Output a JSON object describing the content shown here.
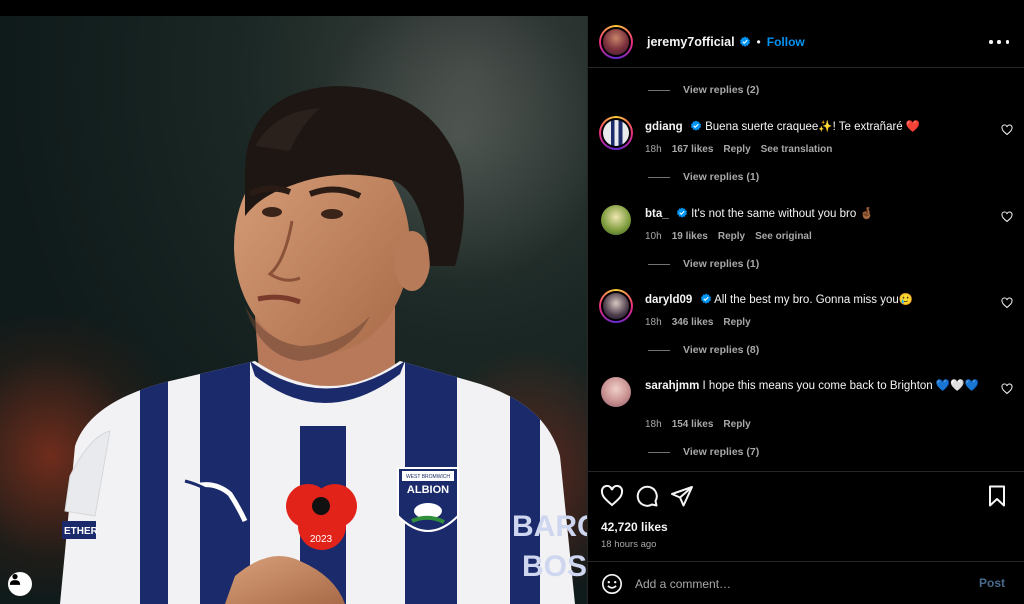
{
  "post": {
    "author": "jeremy7official",
    "follow_label": "Follow",
    "separator": "•",
    "likes": "42,720 likes",
    "time_ago": "18 hours ago"
  },
  "comments": [
    {
      "type": "replies",
      "label": "View replies (2)"
    },
    {
      "type": "comment",
      "user": "gdiang",
      "verified": true,
      "text": "Buena suerte craquee✨! Te extrañaré ❤️",
      "time": "18h",
      "likes": "167 likes",
      "reply": "Reply",
      "extra": "See translation"
    },
    {
      "type": "replies",
      "label": "View replies (1)"
    },
    {
      "type": "comment",
      "user": "bta_",
      "verified": true,
      "text": "It's not the same without you bro 🤞🏾",
      "time": "10h",
      "likes": "19 likes",
      "reply": "Reply",
      "extra": "See original"
    },
    {
      "type": "replies",
      "label": "View replies (1)"
    },
    {
      "type": "comment",
      "user": "daryld09",
      "verified": true,
      "text": "All the best my bro. Gonna miss you🥲",
      "time": "18h",
      "likes": "346 likes",
      "reply": "Reply",
      "extra": ""
    },
    {
      "type": "replies",
      "label": "View replies (8)"
    },
    {
      "type": "comment",
      "user": "sarahjmm",
      "verified": false,
      "text": "I hope this means you come back to Brighton 💙🤍💙",
      "time": "18h",
      "likes": "154 likes",
      "reply": "Reply",
      "extra": ""
    },
    {
      "type": "replies",
      "label": "View replies (7)"
    }
  ],
  "composer": {
    "placeholder": "Add a comment…",
    "post_label": "Post"
  },
  "photo": {
    "shirt_badge_line1": "WEST BROMWICH",
    "shirt_badge_line2": "ALBION",
    "poppy_year": "2023",
    "sponsor": "BARC\nBOS",
    "sleeve_text": "ETHER"
  },
  "colors": {
    "accent": "#0095f6",
    "post_disabled": "#4a6b8c",
    "muted": "#a8a8a8",
    "navy_stripe": "#1b2a6b",
    "poppy_red": "#e2231a"
  },
  "icons": [
    "verified-icon",
    "more-icon",
    "heart-icon",
    "comment-icon",
    "share-icon",
    "bookmark-icon",
    "emoji-icon",
    "user-tag-icon"
  ]
}
